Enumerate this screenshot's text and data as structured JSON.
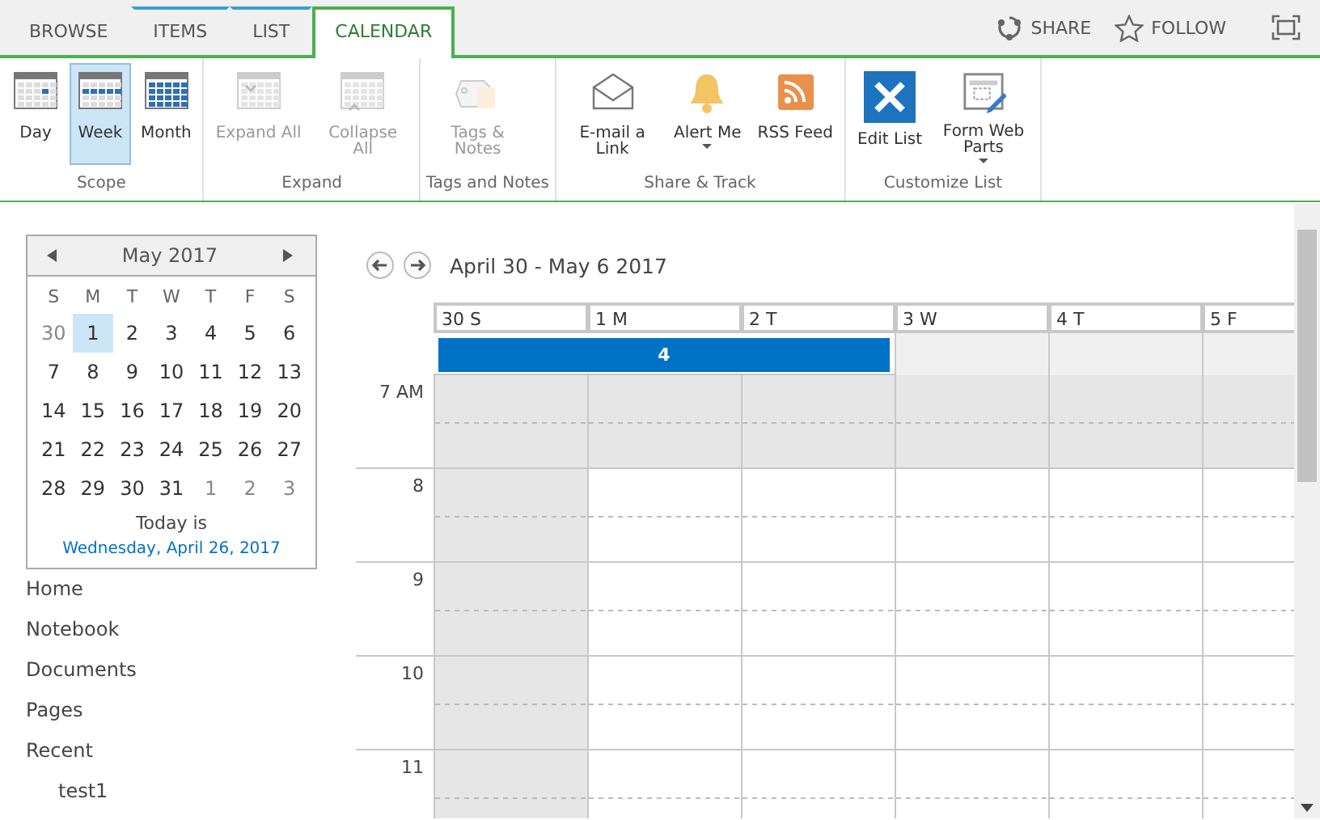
{
  "tabs": [
    {
      "label": "BROWSE",
      "selected": false,
      "contextual": false
    },
    {
      "label": "ITEMS",
      "selected": false,
      "contextual": true
    },
    {
      "label": "LIST",
      "selected": false,
      "contextual": true
    },
    {
      "label": "CALENDAR",
      "selected": true,
      "contextual": false
    }
  ],
  "top_actions": [
    {
      "kind": "share",
      "label": "SHARE"
    },
    {
      "kind": "follow",
      "label": "FOLLOW"
    },
    {
      "kind": "focus"
    }
  ],
  "ribbon": [
    {
      "label": "Scope",
      "buttons": [
        {
          "kind": "day",
          "label": "Day",
          "selected": false,
          "disabled": false
        },
        {
          "kind": "week",
          "label": "Week",
          "selected": true,
          "disabled": false
        },
        {
          "kind": "month",
          "label": "Month",
          "selected": false,
          "disabled": false
        }
      ]
    },
    {
      "label": "Expand",
      "buttons": [
        {
          "kind": "expand",
          "label": "Expand All",
          "selected": false,
          "disabled": true
        },
        {
          "kind": "collapse",
          "label": "Collapse All",
          "selected": false,
          "disabled": true
        }
      ]
    },
    {
      "label": "Tags and Notes",
      "buttons": [
        {
          "kind": "tag",
          "label": "Tags & Notes",
          "selected": false,
          "disabled": true
        }
      ]
    },
    {
      "label": "Share & Track",
      "buttons": [
        {
          "kind": "mail",
          "label": "E-mail a Link",
          "selected": false,
          "disabled": false
        },
        {
          "kind": "bell",
          "label": "Alert Me",
          "dropdown": true,
          "selected": false,
          "disabled": false
        },
        {
          "kind": "rss",
          "label": "RSS Feed",
          "selected": false,
          "disabled": false
        }
      ]
    },
    {
      "label": "Customize List",
      "buttons": [
        {
          "kind": "tools",
          "label": "Edit List",
          "selected": false,
          "disabled": false
        },
        {
          "kind": "form",
          "label": "Form Web Parts",
          "dropdown": true,
          "selected": false,
          "disabled": false
        }
      ]
    }
  ],
  "mini_calendar": {
    "title": "May 2017",
    "weekdays": [
      "S",
      "M",
      "T",
      "W",
      "T",
      "F",
      "S"
    ],
    "weeks": [
      [
        {
          "day": "30",
          "in_month": false,
          "selected": false
        },
        {
          "day": "1",
          "in_month": true,
          "selected": true
        },
        {
          "day": "2",
          "in_month": true,
          "selected": false
        },
        {
          "day": "3",
          "in_month": true,
          "selected": false
        },
        {
          "day": "4",
          "in_month": true,
          "selected": false
        },
        {
          "day": "5",
          "in_month": true,
          "selected": false
        },
        {
          "day": "6",
          "in_month": true,
          "selected": false
        }
      ],
      [
        {
          "day": "7",
          "in_month": true,
          "selected": false
        },
        {
          "day": "8",
          "in_month": true,
          "selected": false
        },
        {
          "day": "9",
          "in_month": true,
          "selected": false
        },
        {
          "day": "10",
          "in_month": true,
          "selected": false
        },
        {
          "day": "11",
          "in_month": true,
          "selected": false
        },
        {
          "day": "12",
          "in_month": true,
          "selected": false
        },
        {
          "day": "13",
          "in_month": true,
          "selected": false
        }
      ],
      [
        {
          "day": "14",
          "in_month": true,
          "selected": false
        },
        {
          "day": "15",
          "in_month": true,
          "selected": false
        },
        {
          "day": "16",
          "in_month": true,
          "selected": false
        },
        {
          "day": "17",
          "in_month": true,
          "selected": false
        },
        {
          "day": "18",
          "in_month": true,
          "selected": false
        },
        {
          "day": "19",
          "in_month": true,
          "selected": false
        },
        {
          "day": "20",
          "in_month": true,
          "selected": false
        }
      ],
      [
        {
          "day": "21",
          "in_month": true,
          "selected": false
        },
        {
          "day": "22",
          "in_month": true,
          "selected": false
        },
        {
          "day": "23",
          "in_month": true,
          "selected": false
        },
        {
          "day": "24",
          "in_month": true,
          "selected": false
        },
        {
          "day": "25",
          "in_month": true,
          "selected": false
        },
        {
          "day": "26",
          "in_month": true,
          "selected": false
        },
        {
          "day": "27",
          "in_month": true,
          "selected": false
        }
      ],
      [
        {
          "day": "28",
          "in_month": true,
          "selected": false
        },
        {
          "day": "29",
          "in_month": true,
          "selected": false
        },
        {
          "day": "30",
          "in_month": true,
          "selected": false
        },
        {
          "day": "31",
          "in_month": true,
          "selected": false
        },
        {
          "day": "1",
          "in_month": false,
          "selected": false
        },
        {
          "day": "2",
          "in_month": false,
          "selected": false
        },
        {
          "day": "3",
          "in_month": false,
          "selected": false
        }
      ]
    ],
    "today_label": "Today is",
    "today_link": "Wednesday, April 26, 2017"
  },
  "nav": {
    "items": [
      {
        "label": "Home"
      },
      {
        "label": "Notebook"
      },
      {
        "label": "Documents"
      },
      {
        "label": "Pages"
      },
      {
        "label": "Recent",
        "children": [
          {
            "label": "test1"
          }
        ]
      }
    ]
  },
  "week_view": {
    "range": "April 30 - May 6 2017",
    "days": [
      {
        "label": "30 S",
        "weekend": true,
        "in_event": true
      },
      {
        "label": "1 M",
        "weekend": false,
        "in_event": true
      },
      {
        "label": "2 T",
        "weekend": false,
        "in_event": true
      },
      {
        "label": "3 W",
        "weekend": false,
        "in_event": false
      },
      {
        "label": "4 T",
        "weekend": false,
        "in_event": false
      },
      {
        "label": "5 F",
        "weekend": false,
        "in_event": false
      }
    ],
    "all_day_event": {
      "label": "4"
    },
    "hours": [
      {
        "label": "7 AM",
        "off_hours": true
      },
      {
        "label": "8",
        "off_hours": false
      },
      {
        "label": "9",
        "off_hours": false
      },
      {
        "label": "10",
        "off_hours": false
      },
      {
        "label": "11",
        "off_hours": false
      }
    ]
  }
}
